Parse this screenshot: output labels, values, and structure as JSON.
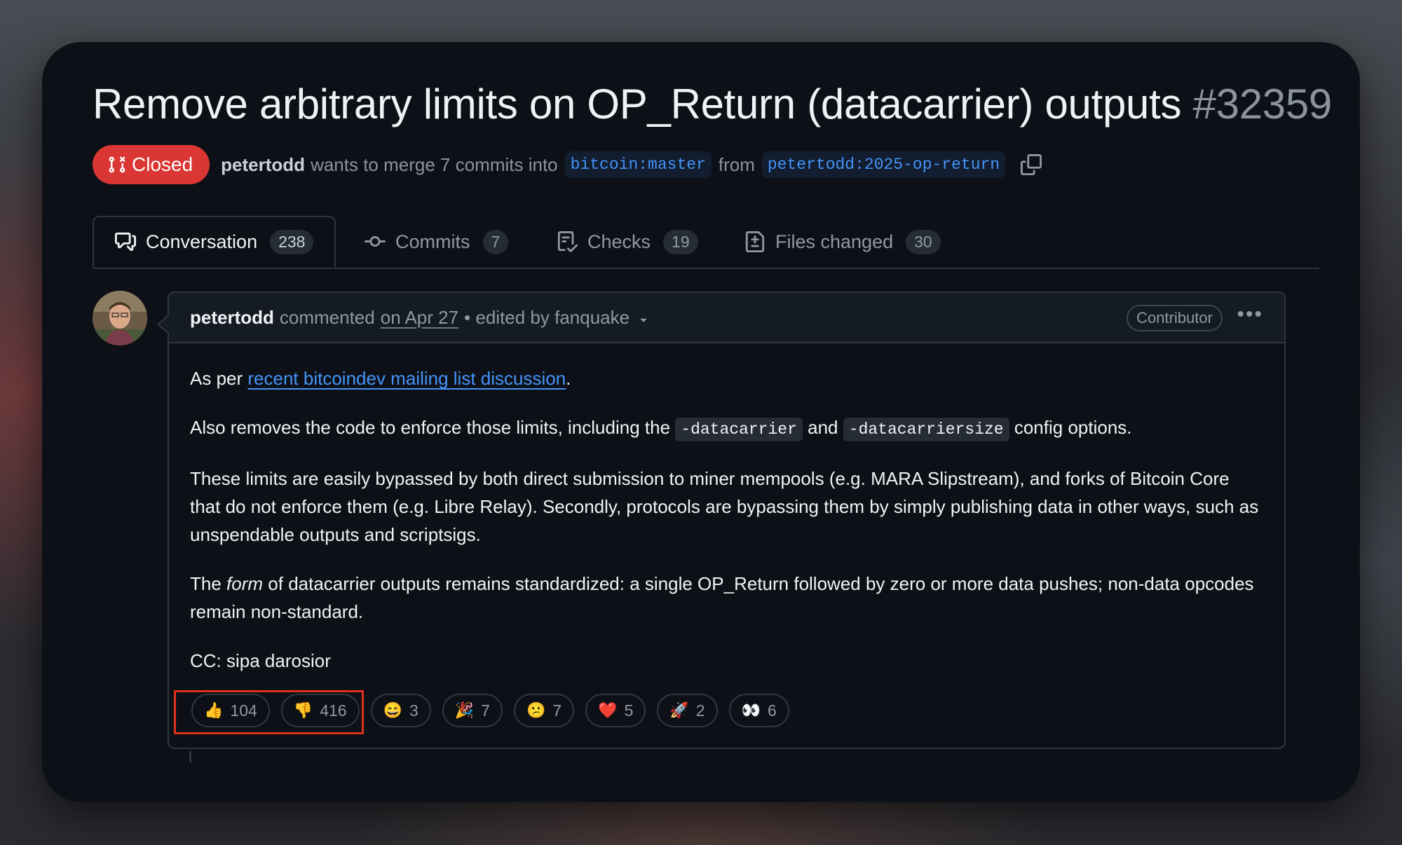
{
  "pr": {
    "title": "Remove arbitrary limits on OP_Return (datacarrier) outputs",
    "number": "#32359",
    "state": "Closed",
    "author": "petertodd",
    "merge_text": "wants to merge 7 commits into",
    "base_branch": "bitcoin:master",
    "from_text": "from",
    "head_branch": "petertodd:2025-op-return"
  },
  "tabs": [
    {
      "label": "Conversation",
      "count": "238",
      "icon": "comment-discussion-icon"
    },
    {
      "label": "Commits",
      "count": "7",
      "icon": "git-commit-icon"
    },
    {
      "label": "Checks",
      "count": "19",
      "icon": "checklist-icon"
    },
    {
      "label": "Files changed",
      "count": "30",
      "icon": "file-diff-icon"
    }
  ],
  "comment": {
    "author": "petertodd",
    "action": "commented",
    "date": "on Apr 27",
    "edited": "• edited by fanquake",
    "badge": "Contributor",
    "p1_pre": "As per",
    "p1_link": "recent bitcoindev mailing list discussion",
    "p1_post": ".",
    "p2_pre": "Also removes the code to enforce those limits, including the",
    "p2_code1": "-datacarrier",
    "p2_mid": "and",
    "p2_code2": "-datacarriersize",
    "p2_post": "config options.",
    "p3": "These limits are easily bypassed by both direct submission to miner mempools (e.g. MARA Slipstream), and forks of Bitcoin Core that do not enforce them (e.g. Libre Relay). Secondly, protocols are bypassing them by simply publishing data in other ways, such as unspendable outputs and scriptsigs.",
    "p4_pre": "The",
    "p4_em": "form",
    "p4_post": "of datacarrier outputs remains standardized: a single OP_Return followed by zero or more data pushes; non-data opcodes remain non-standard.",
    "p5": "CC: sipa darosior"
  },
  "reactions": [
    {
      "emoji": "👍",
      "count": "104"
    },
    {
      "emoji": "👎",
      "count": "416"
    },
    {
      "emoji": "😄",
      "count": "3"
    },
    {
      "emoji": "🎉",
      "count": "7"
    },
    {
      "emoji": "😕",
      "count": "7"
    },
    {
      "emoji": "❤️",
      "count": "5"
    },
    {
      "emoji": "🚀",
      "count": "2"
    },
    {
      "emoji": "👀",
      "count": "6"
    }
  ],
  "colors": {
    "closed": "#da3633",
    "link": "#4493f8",
    "highlight": "#e0301e",
    "background": "#0d1117"
  }
}
